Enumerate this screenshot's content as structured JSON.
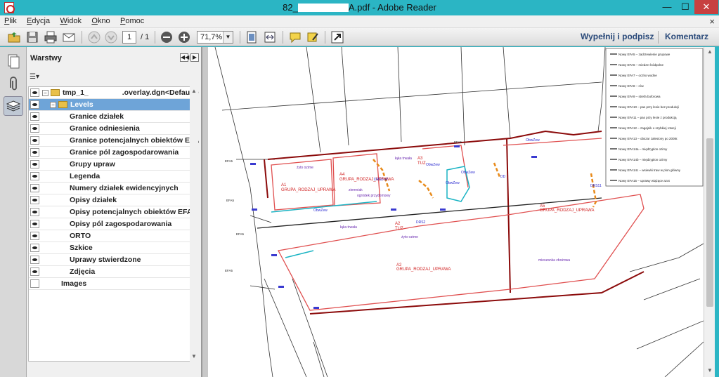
{
  "window": {
    "title_prefix": "82_",
    "title_suffix": "A.pdf - Adobe Reader",
    "minimize": "—",
    "maximize": "☐",
    "close": "✕"
  },
  "menu": {
    "items": [
      "Plik",
      "Edycja",
      "Widok",
      "Okno",
      "Pomoc"
    ],
    "close_doc": "×"
  },
  "toolbar": {
    "page_current": "1",
    "page_total": "/ 1",
    "zoom": "71,7%",
    "fill_sign": "Wypełnij i podpisz",
    "comment": "Komentarz"
  },
  "layers_panel": {
    "title": "Warstwy",
    "root": {
      "name": "tmp_1_",
      "name_suffix": ".overlay.dgn<Default>"
    },
    "group": "Levels",
    "levels": [
      "Granice działek",
      "Granice odniesienia",
      "Granice potencjalnych obiektów EFA",
      "Granice pól zagospodarowania",
      "Grupy upraw",
      "Legenda",
      "Numery działek ewidencyjnych",
      "Opisy działek",
      "Opisy potencjalnych obiektów EFA",
      "Opisy pól zagospodarowania",
      "ORTO",
      "Szkice",
      "Uprawy stwierdzone",
      "Zdjęcia"
    ],
    "images": "Images"
  },
  "map": {
    "legend": [
      "Nowy EFA5 – zadrzewienie grupowe",
      "Nowy EFA6 – miedze śródpolne",
      "Nowy EFA7 – oczko wodne",
      "Nowy EFA8 – rów",
      "Nowy EFA9 – strefa buforowa",
      "Nowy EFA10 – pas przy lesie bez produkcji",
      "Nowy EFA11 – pas przy lesie z produkcją",
      "Nowy EFA12 – zagajnik o szybkiej rotacji",
      "Nowy EFA13 – obszar zalesiony po 2008r.",
      "Nowy EFA14a – międzyplon ozimy",
      "Nowy EFA14b – międzyplon ozimy",
      "Nowy EFA14c – wsiewki traw w plon główny",
      "Nowy EFA15 – uprawy wiążące azot"
    ],
    "labels": {
      "a1": "A1",
      "a1_group": "GRUPA_RODZAJ_UPRAWA",
      "a4": "A4",
      "a4_group": "GRUPA_RODZAJ_UPRAWA",
      "a2": "A2",
      "a2_group": "GRUPA_RODZAJ_UPRAWA",
      "a3": "A3",
      "a3_tuz": "TUZ",
      "a5": "A5",
      "a5_group": "GRUPA_RODZAJ_UPRAWA",
      "a2b": "A2",
      "a2b_tuz": "TUZ",
      "zyto": "żyto ozime",
      "zyto2": "żyto ozime",
      "ziemniak": "ziemniak",
      "ogrodek": "ogródek przydomowy",
      "laka": "łąka trwała",
      "laka2": "łąka trwała",
      "mieszanka": "mieszanka zbożowa",
      "obwzew1": "ObwZew",
      "obwzew2": "ObwZew",
      "obwzew3": "ObwZew",
      "obwzew4": "ObwZew",
      "obwzew5": "ObwZew",
      "drs": "DRS2-W",
      "drs2": "DRS2",
      "drs3": "DRS11",
      "dd": "DD",
      "efa1": "EFA5",
      "efa2": "EFA5",
      "efa3": "EFA5",
      "efa4": "EFA5",
      "efa5": "EFA5"
    }
  }
}
